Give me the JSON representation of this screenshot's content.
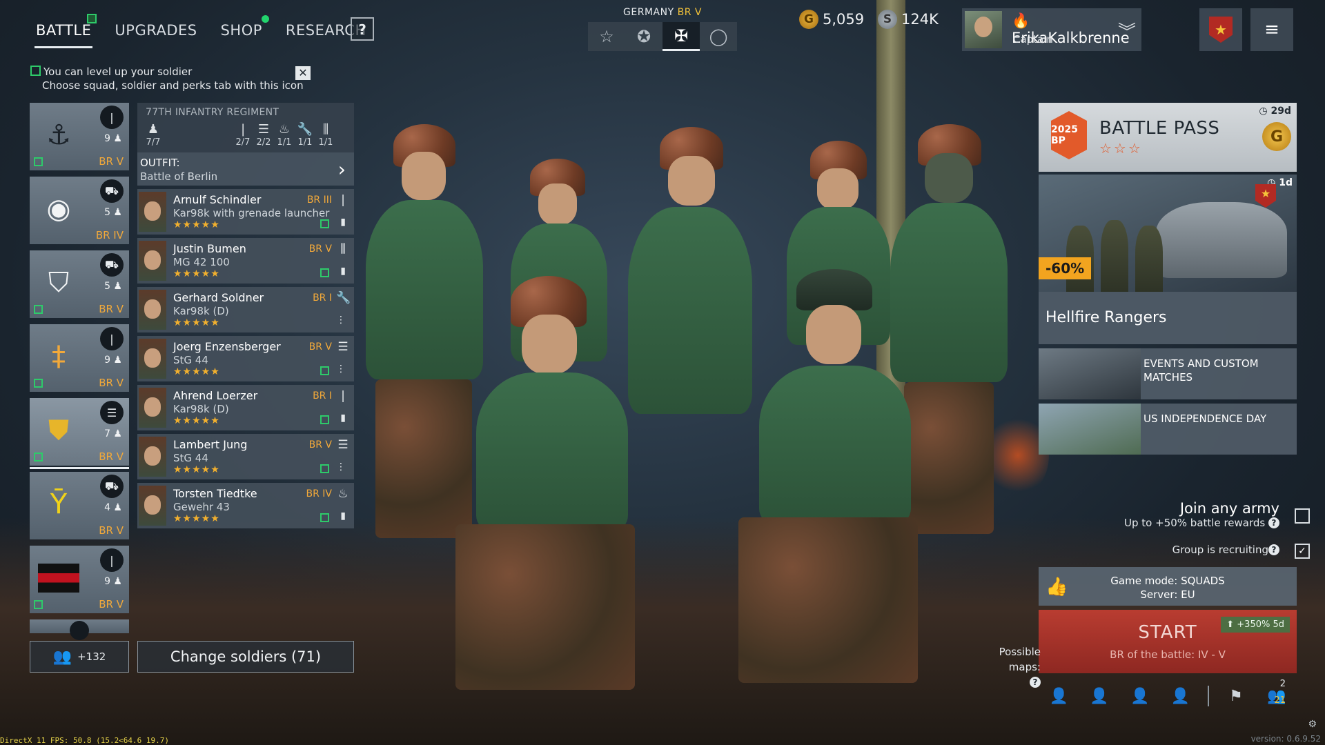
{
  "nav": {
    "tabs": [
      {
        "label": "BATTLE",
        "active": true,
        "badge": "square"
      },
      {
        "label": "UPGRADES",
        "active": false
      },
      {
        "label": "SHOP",
        "active": false,
        "badge": "dot"
      },
      {
        "label": "RESEARCH",
        "active": false
      }
    ],
    "help": "?"
  },
  "hint": {
    "line1": "You can level up your soldier",
    "line2": "Choose squad, soldier and perks tab with this icon",
    "close": "✕"
  },
  "army": {
    "country": "GERMANY",
    "br": "BR V",
    "icons": [
      "star-outline-icon",
      "star-circle-icon",
      "iron-cross-icon",
      "circle-icon"
    ],
    "selected_index": 2
  },
  "currency": {
    "gold": "5,059",
    "silver": "124K"
  },
  "profile": {
    "name": "🔥ErikaKalkbrenne",
    "rank": "Captain"
  },
  "squads": [
    {
      "emblem": "anchor-emblem",
      "type_icon": "rifle-icon",
      "count": "9",
      "br": "BR V"
    },
    {
      "emblem": "shield-ring-emblem",
      "type_icon": "motorcycle-icon",
      "count": "5",
      "br": "BR IV"
    },
    {
      "emblem": "antlers-shield-emblem",
      "type_icon": "motorcycle-icon",
      "count": "5",
      "br": "BR V"
    },
    {
      "emblem": "wolfsangel-emblem",
      "type_icon": "rifle-icon",
      "count": "9",
      "br": "BR V"
    },
    {
      "emblem": "flame-shield-emblem",
      "type_icon": "assault-rifle-icon",
      "count": "7",
      "br": "BR V",
      "selected": true
    },
    {
      "emblem": "yew-rune-emblem",
      "type_icon": "vehicle-icon",
      "count": "4",
      "br": "BR V"
    },
    {
      "emblem": "tricolor-flag-emblem",
      "type_icon": "rifle-icon",
      "count": "9",
      "br": "BR V"
    }
  ],
  "friends": {
    "count": "+132"
  },
  "detail": {
    "regiment": "77TH INFANTRY REGIMENT",
    "stats": [
      {
        "icon": "soldier-icon",
        "value": "7/7"
      },
      {
        "icon": "rifle-icon",
        "value": "2/7"
      },
      {
        "icon": "assault-rifle-icon",
        "value": "2/2"
      },
      {
        "icon": "flamethrower-icon",
        "value": "1/1"
      },
      {
        "icon": "wrench-icon",
        "value": "1/1"
      },
      {
        "icon": "mg-icon",
        "value": "1/1"
      }
    ],
    "outfit_label": "OUTFIT:",
    "outfit_value": "Battle of Berlin"
  },
  "soldiers": [
    {
      "name": "Arnulf Schindler",
      "weapon": "Kar98k with grenade launcher",
      "br": "BR III",
      "icon": "rifle-icon",
      "stars": "★★★★★"
    },
    {
      "name": "Justin Bumen",
      "weapon": "MG 42 100",
      "br": "BR V",
      "icon": "mg-icon",
      "stars": "★★★★★"
    },
    {
      "name": "Gerhard Soldner",
      "weapon": "Kar98k (D)",
      "br": "BR I",
      "icon": "wrench-icon",
      "stars": "★★★★★"
    },
    {
      "name": "Joerg Enzensberger",
      "weapon": "StG 44",
      "br": "BR V",
      "icon": "assault-rifle-icon",
      "stars": "★★★★★"
    },
    {
      "name": "Ahrend Loerzer",
      "weapon": "Kar98k (D)",
      "br": "BR I",
      "icon": "rifle-icon",
      "stars": "★★★★★"
    },
    {
      "name": "Lambert Jung",
      "weapon": "StG 44",
      "br": "BR V",
      "icon": "assault-rifle-icon",
      "stars": "★★★★★"
    },
    {
      "name": "Torsten Tiedtke",
      "weapon": "Gewehr 43",
      "br": "BR IV",
      "icon": "flamethrower-icon",
      "stars": "★★★★★"
    }
  ],
  "change_soldiers": "Change soldiers (71)",
  "battle_pass": {
    "title": "BATTLE PASS",
    "badge": "2025 BP",
    "stars": "☆☆☆",
    "timer": "29d",
    "coin": "G"
  },
  "promo": {
    "sale": "-60%",
    "timer": "1d",
    "name": "Hellfire Rangers"
  },
  "events": [
    {
      "label": "EVENTS AND CUSTOM MATCHES"
    },
    {
      "label": "US INDEPENDENCE DAY"
    }
  ],
  "join": {
    "title": "Join any army",
    "sub": "Up to +50% battle rewards",
    "recruiting": "Group is recruiting",
    "join_checked": false,
    "recruiting_checked": true
  },
  "game_mode": {
    "mode": "Game mode: SQUADS",
    "server": "Server: EU"
  },
  "start": {
    "label": "START",
    "sub": "BR of the battle: IV - V",
    "xp": "+350% 5d"
  },
  "maps_label": "Possible maps:",
  "party": {
    "count": "2",
    "req": "21"
  },
  "fps_text": "DirectX 11 FPS: 50.8 (15.2<64.6 19.7)",
  "version": "version: 0.6.9.52",
  "colors": {
    "accent_gold": "#f2a93a",
    "perk_green": "#2ecb6a",
    "start_red": "#c43e32",
    "bp_orange": "#e25a2a"
  }
}
